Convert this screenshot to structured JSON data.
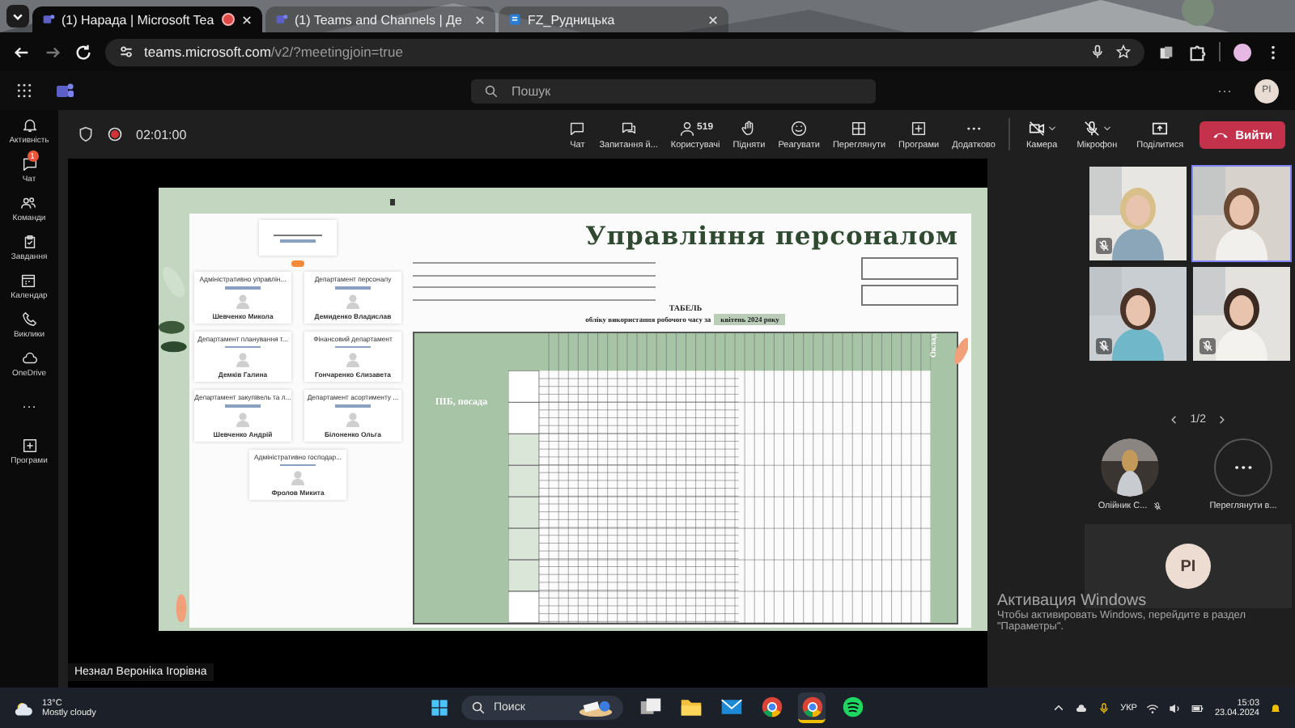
{
  "browser": {
    "tabs": [
      {
        "title": "(1) Нарада | Microsoft Tea",
        "selected": true,
        "recording": true
      },
      {
        "title": "(1) Teams and Channels | Де",
        "selected": false,
        "recording": false
      },
      {
        "title": "FZ_Рудницька",
        "selected": false,
        "recording": false
      }
    ],
    "url_host": "teams.microsoft.com",
    "url_path": "/v2/?meetingjoin=true"
  },
  "teams": {
    "search": {
      "placeholder": "Пошук"
    },
    "more": "···",
    "avatar": "PI"
  },
  "rail": [
    {
      "label": "Активність",
      "kind": "bell"
    },
    {
      "label": "Чат",
      "kind": "chat",
      "badge": "1"
    },
    {
      "label": "Команди",
      "kind": "teams"
    },
    {
      "label": "Завдання",
      "kind": "tasks"
    },
    {
      "label": "Календар",
      "kind": "calendar"
    },
    {
      "label": "Виклики",
      "kind": "calls"
    },
    {
      "label": "OneDrive",
      "kind": "cloud"
    },
    {
      "label": "···",
      "kind": "more"
    },
    {
      "label": "Програми",
      "kind": "apps"
    }
  ],
  "meeting": {
    "timer": "02:01:00",
    "controls": [
      {
        "label": "Чат",
        "kind": "chat"
      },
      {
        "label": "Запитання й...",
        "kind": "qa"
      },
      {
        "label": "Користувачі",
        "kind": "people",
        "count": "519"
      },
      {
        "label": "Підняти",
        "kind": "hand"
      },
      {
        "label": "Реагувати",
        "kind": "react"
      },
      {
        "label": "Переглянути",
        "kind": "view"
      },
      {
        "label": "Програми",
        "kind": "apps"
      },
      {
        "label": "Додатково",
        "kind": "more"
      }
    ],
    "devices": [
      {
        "label": "Камера",
        "kind": "camera",
        "off": true
      },
      {
        "label": "Мікрофон",
        "kind": "mic",
        "off": true
      },
      {
        "label": "Поділитися",
        "kind": "share",
        "off": false
      }
    ],
    "leave": "Вийти"
  },
  "slide": {
    "title": "Управління персоналом",
    "org": [
      {
        "title": "Адміністративно управлін...",
        "person": "Шевченко Микола"
      },
      {
        "title": "Департамент персоналу",
        "person": "Демиденко Владислав"
      },
      {
        "title": "Департамент планування т...",
        "person": "Демків Галина"
      },
      {
        "title": "Фінансовий департамент",
        "person": "Гончаренко Єлизавета"
      },
      {
        "title": "Департамент закупівель та л...",
        "person": "Шевченко Андрій"
      },
      {
        "title": "Департамент асортименту ...",
        "person": "Білоненко Ольга"
      },
      {
        "title": "Адміністративно господар...",
        "person": "Фролов Микита"
      }
    ],
    "sheet": {
      "heading": "ТАБЕЛЬ",
      "subheading": "обліку використання робочого часу за",
      "period": "квітень 2024 року",
      "name_column": "ПІБ, посада",
      "salary_column": "Оклад"
    }
  },
  "presenter": "Незнал Вероніка Ігорівна",
  "participants": {
    "tiles": [
      {
        "muted": true,
        "selected": false
      },
      {
        "muted": false,
        "selected": true
      },
      {
        "muted": true,
        "selected": false
      },
      {
        "muted": true,
        "selected": false
      }
    ],
    "pager": "1/2",
    "others": [
      {
        "name": "Олійник С...",
        "kind": "person",
        "muted": true
      },
      {
        "name": "Переглянути в...",
        "kind": "more",
        "muted": false
      }
    ],
    "self": "PI"
  },
  "activation": {
    "title": "Активация Windows",
    "text": "Чтобы активировать Windows, перейдите в раздел \"Параметры\"."
  },
  "taskbar": {
    "temp": "13°C",
    "weather": "Mostly cloudy",
    "search": {
      "placeholder": "Поиск"
    },
    "apps": [
      {
        "kind": "taskview",
        "selected": false
      },
      {
        "kind": "folder",
        "selected": false
      },
      {
        "kind": "mail",
        "selected": false
      },
      {
        "kind": "chrome",
        "selected": false
      },
      {
        "kind": "chrome",
        "selected": true
      },
      {
        "kind": "spotify",
        "selected": false
      }
    ],
    "lang": "УКР",
    "time": "15:03",
    "date": "23.04.2024"
  }
}
